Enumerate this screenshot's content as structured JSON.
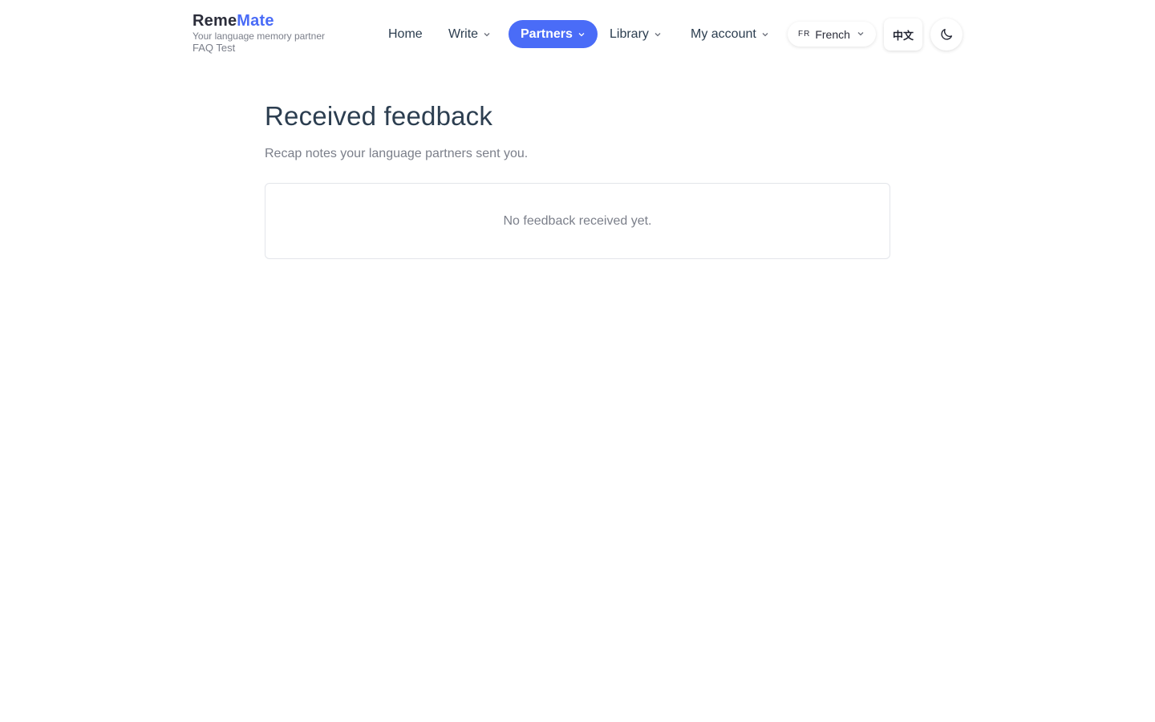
{
  "brand": {
    "name_part1": "Reme",
    "name_part2": "Mate",
    "tagline": "Your language memory partner",
    "user": "FAQ Test"
  },
  "nav": {
    "items": [
      {
        "label": "Home",
        "has_dropdown": false,
        "active": false
      },
      {
        "label": "Write",
        "has_dropdown": true,
        "active": false
      },
      {
        "label": "Partners",
        "has_dropdown": true,
        "active": true
      },
      {
        "label": "Library",
        "has_dropdown": true,
        "active": false
      },
      {
        "label": "My account",
        "has_dropdown": true,
        "active": false
      }
    ]
  },
  "language_select": {
    "code": "FR",
    "label": "French"
  },
  "locale_toggle": {
    "label": "中文"
  },
  "theme_toggle": {
    "icon": "moon-icon"
  },
  "main": {
    "title": "Received feedback",
    "subtitle": "Recap notes your language partners sent you.",
    "empty_message": "No feedback received yet."
  },
  "colors": {
    "accent": "#4a6cf7",
    "text": "#2c3e50",
    "muted": "#7b7f8a"
  }
}
